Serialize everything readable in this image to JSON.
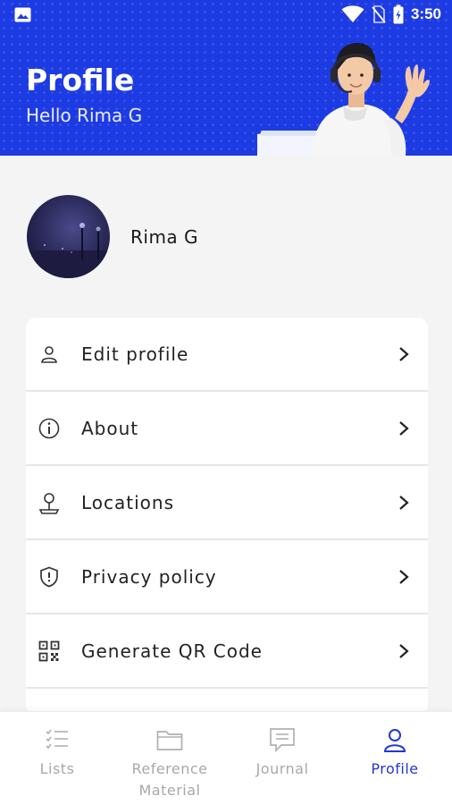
{
  "status_bar": {
    "time": "3:50"
  },
  "header": {
    "title": "Profile",
    "subtitle": "Hello Rima G"
  },
  "profile": {
    "name": "Rima G"
  },
  "menu": [
    {
      "label": "Edit profile",
      "icon": "user-icon"
    },
    {
      "label": "About",
      "icon": "info-icon"
    },
    {
      "label": "Locations",
      "icon": "location-pin-icon"
    },
    {
      "label": "Privacy policy",
      "icon": "shield-icon"
    },
    {
      "label": "Generate QR Code",
      "icon": "qr-code-icon"
    }
  ],
  "bottom_nav": [
    {
      "label": "Lists",
      "icon": "checklist-icon",
      "active": false
    },
    {
      "label": "Reference Material",
      "icon": "folder-icon",
      "active": false
    },
    {
      "label": "Journal",
      "icon": "message-icon",
      "active": false
    },
    {
      "label": "Profile",
      "icon": "user-icon",
      "active": true
    }
  ],
  "colors": {
    "header_bg": "#1d3be2",
    "active_nav": "#2038d6",
    "inactive_nav": "#a8a8a8"
  }
}
